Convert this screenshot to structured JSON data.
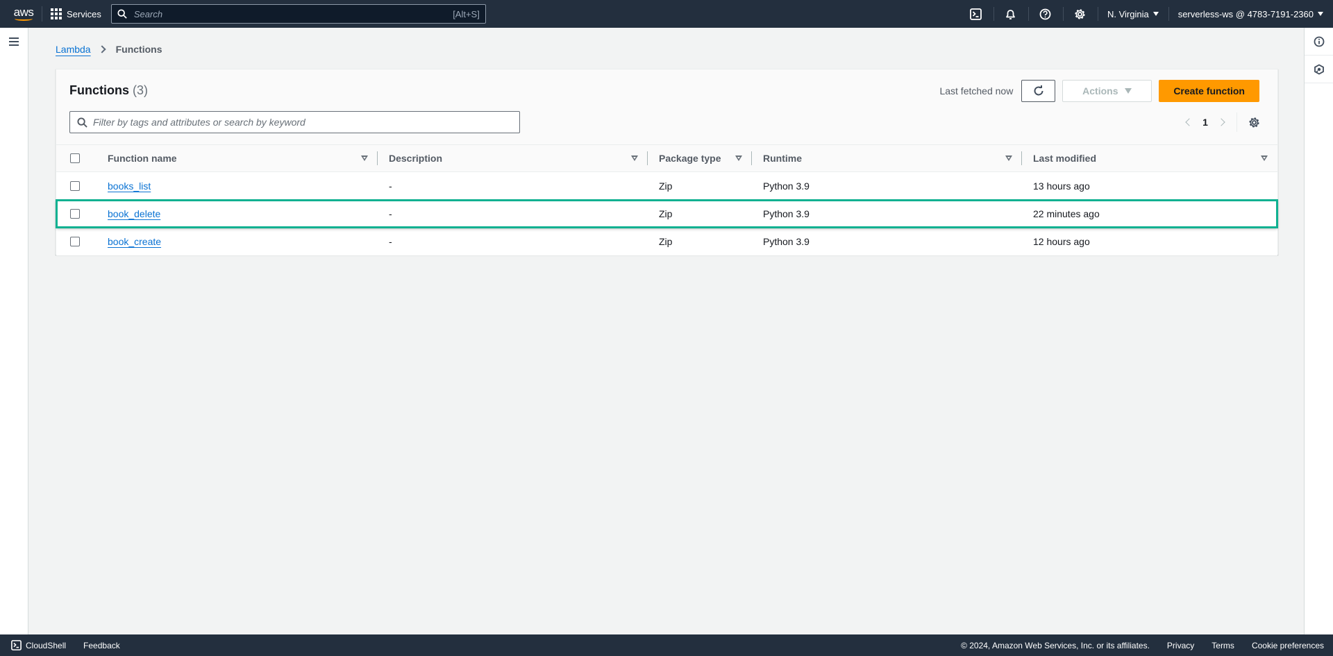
{
  "topnav": {
    "logo_text": "aws",
    "services_label": "Services",
    "search_placeholder": "Search",
    "search_shortcut": "[Alt+S]",
    "icons": [
      "cloudshell-icon",
      "notifications-icon",
      "help-icon",
      "settings-icon"
    ],
    "region": "N. Virginia",
    "account": "serverless-ws @ 4783-7191-2360"
  },
  "breadcrumb": {
    "items": [
      {
        "label": "Lambda",
        "link": true
      },
      {
        "label": "Functions",
        "link": false
      }
    ]
  },
  "panel": {
    "title": "Functions",
    "count": "(3)",
    "last_fetched": "Last fetched now",
    "actions_label": "Actions",
    "create_label": "Create function",
    "filter_placeholder": "Filter by tags and attributes or search by keyword",
    "page": "1"
  },
  "table": {
    "columns": [
      "Function name",
      "Description",
      "Package type",
      "Runtime",
      "Last modified"
    ],
    "rows": [
      {
        "name": "books_list",
        "description": "-",
        "package_type": "Zip",
        "runtime": "Python 3.9",
        "last_modified": "13 hours ago",
        "highlighted": false
      },
      {
        "name": "book_delete",
        "description": "-",
        "package_type": "Zip",
        "runtime": "Python 3.9",
        "last_modified": "22 minutes ago",
        "highlighted": true
      },
      {
        "name": "book_create",
        "description": "-",
        "package_type": "Zip",
        "runtime": "Python 3.9",
        "last_modified": "12 hours ago",
        "highlighted": false
      }
    ]
  },
  "colors": {
    "nav_bg": "#232f3e",
    "primary_button": "#ff9900",
    "link": "#0972d3",
    "highlight_outline": "#10b191"
  },
  "footer": {
    "cloudshell_label": "CloudShell",
    "feedback_label": "Feedback",
    "copyright": "© 2024, Amazon Web Services, Inc. or its affiliates.",
    "links": [
      "Privacy",
      "Terms",
      "Cookie preferences"
    ]
  }
}
